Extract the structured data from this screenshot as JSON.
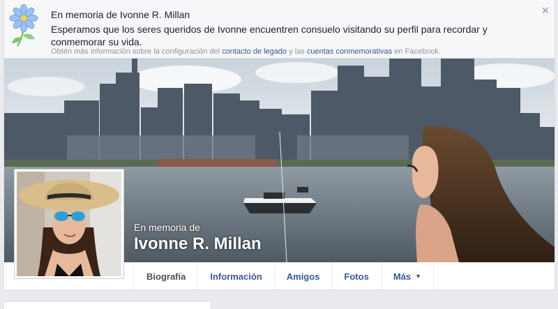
{
  "banner": {
    "title": "En memoria de Ivonne R. Millan",
    "body": "Esperamos que los seres queridos de Ivonne encuentren consuelo visitando su perfil para recordar y conmemorar su vida.",
    "foot_prefix": "Obtén más información sobre la configuración del ",
    "foot_link1": "contacto de legado",
    "foot_mid": " y las ",
    "foot_link2": "cuentas conmemorativas",
    "foot_suffix": " en Facebook.",
    "close_icon": "×"
  },
  "cover": {
    "memorial_label": "En memoria de",
    "name": "Ivonne R. Millan"
  },
  "tabs": [
    {
      "label": "Biografía"
    },
    {
      "label": "Información"
    },
    {
      "label": "Amigos"
    },
    {
      "label": "Fotos"
    },
    {
      "label": "Más"
    }
  ],
  "icons": {
    "more_caret": "▼",
    "flower": "memorial-flower-icon"
  },
  "colors": {
    "link": "#365899",
    "banner_bg": "#f6f7f9",
    "page_bg": "#e9ebee"
  }
}
